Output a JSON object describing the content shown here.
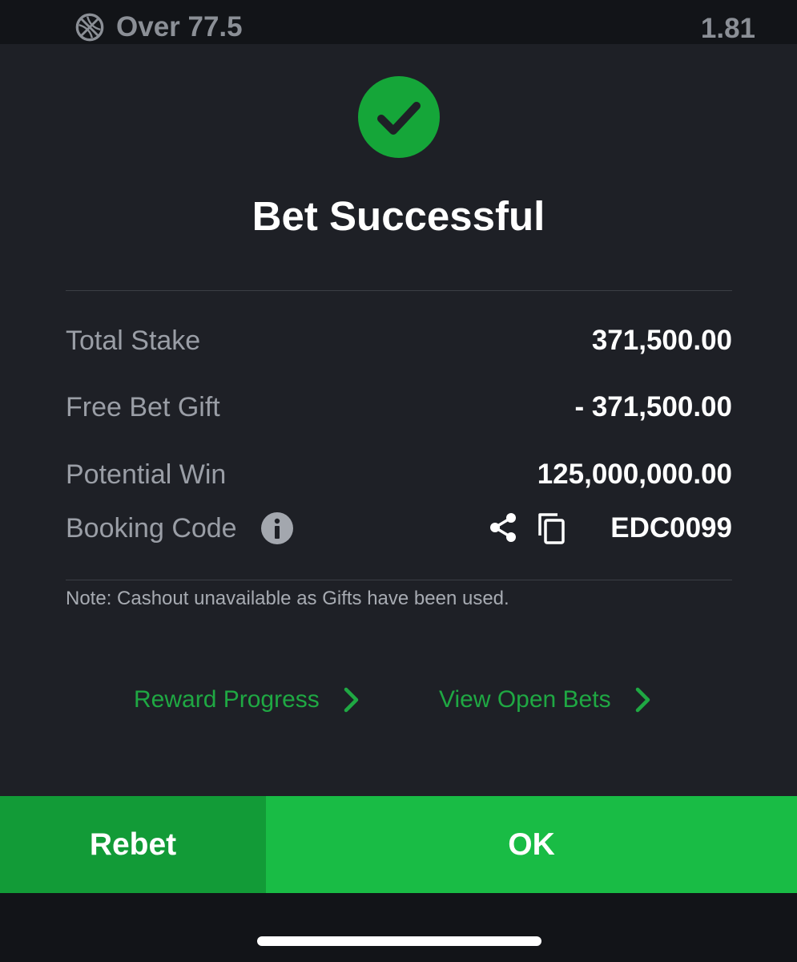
{
  "background_bet": {
    "icon": "basketball-icon",
    "market": "Over 77.5",
    "odds": "1.81"
  },
  "modal": {
    "status_icon": "check-circle-icon",
    "title": "Bet Successful",
    "details": {
      "total_stake": {
        "label": "Total Stake",
        "value": "371,500.00"
      },
      "free_bet_gift": {
        "label": "Free Bet Gift",
        "value": "- 371,500.00"
      },
      "potential_win": {
        "label": "Potential Win",
        "value": "125,000,000.00"
      },
      "booking_code": {
        "label": "Booking Code",
        "value": "EDC0099",
        "info_icon": "info-icon",
        "share_icon": "share-icon",
        "copy_icon": "copy-icon"
      }
    },
    "note": "Note: Cashout unavailable as Gifts have been used.",
    "links": {
      "reward_progress": "Reward Progress",
      "view_open_bets": "View Open Bets"
    }
  },
  "actions": {
    "rebet": "Rebet",
    "ok": "OK"
  },
  "colors": {
    "accent_green": "#1fa843",
    "ok_button": "#19bc45",
    "rebet_button": "#129b37",
    "modal_background": "#1e2026",
    "label_gray": "#9a9ea6"
  }
}
